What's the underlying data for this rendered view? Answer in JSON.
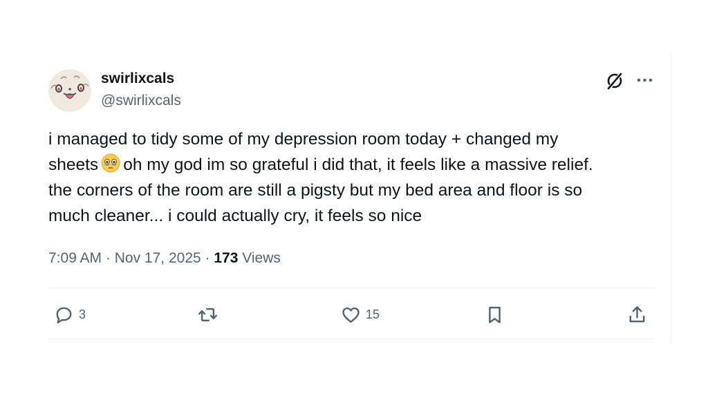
{
  "tweet": {
    "author": {
      "display_name": "swirlixcals",
      "handle": "@swirlixcals"
    },
    "text_lines": [
      "i managed to tidy some of my depression room today + changed my",
      "sheets",
      "oh my god im so grateful i did that, it feels like a massive relief.",
      "the corners of the room are still a pigsty but my bed area and floor is so",
      "much cleaner... i could actually cry, it feels so nice"
    ],
    "emoji": "holding-back-tears-emoji",
    "time": "7:09 AM",
    "separator": "·",
    "date": "Nov 17, 2025",
    "views_count": "173",
    "views_label": "Views"
  },
  "actions": {
    "reply_count": "3",
    "like_count": "15"
  },
  "colors": {
    "text": "#0f1419",
    "secondary": "#536471",
    "divider": "#eff3f4"
  }
}
